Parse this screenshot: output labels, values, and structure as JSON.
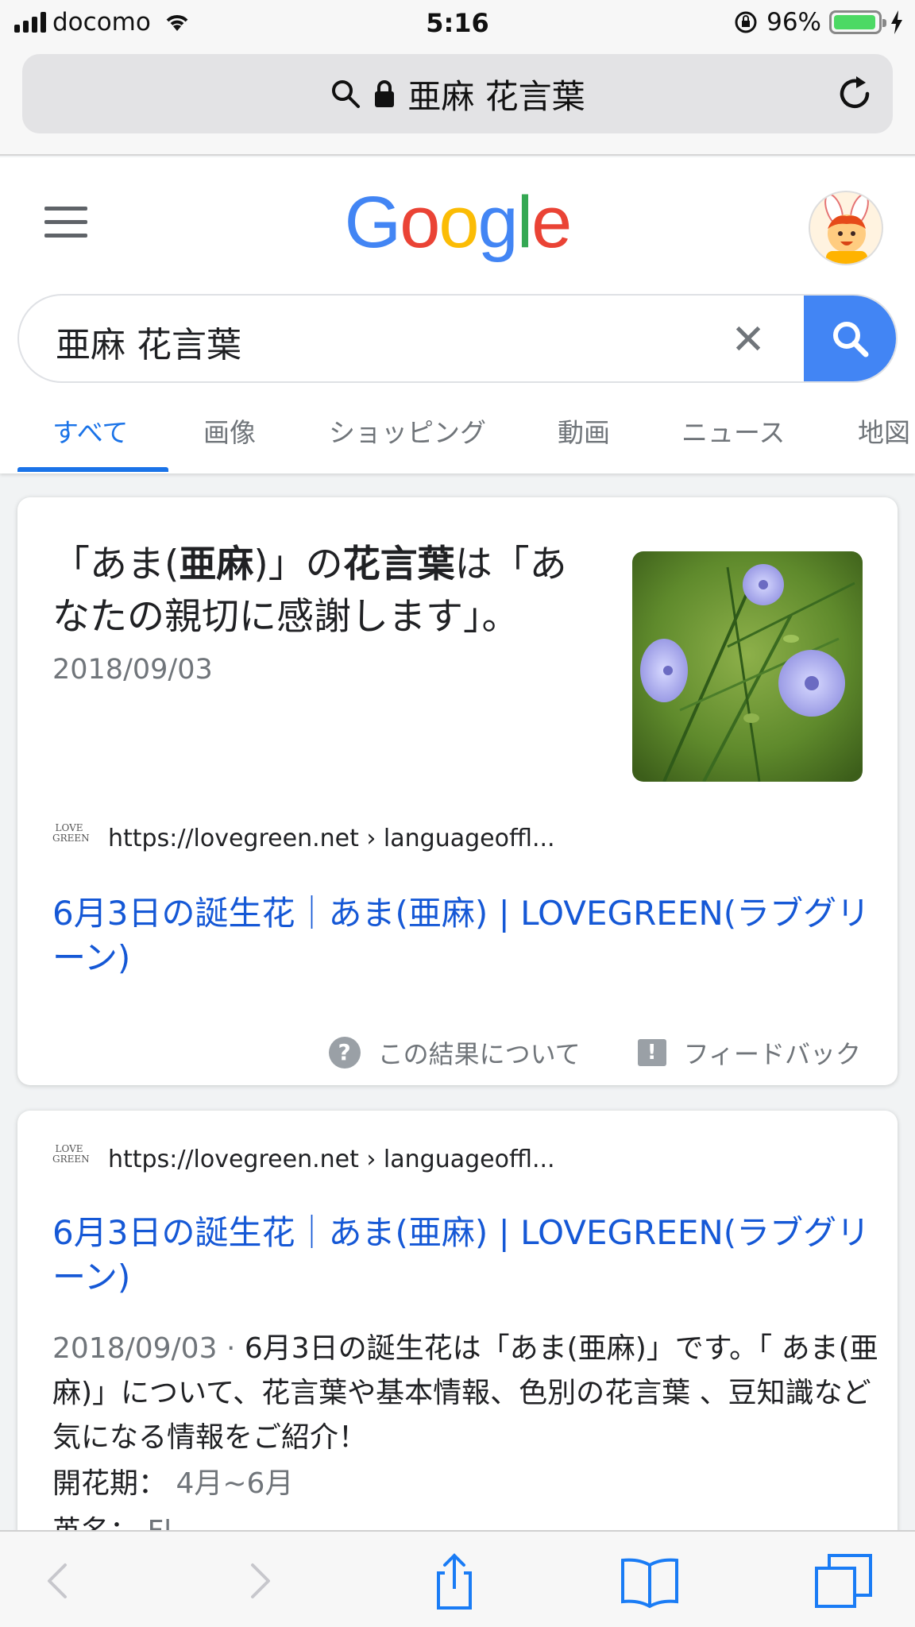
{
  "status_bar": {
    "carrier": "docomo",
    "time": "5:16",
    "battery_percent": "96%",
    "battery_level": 0.96
  },
  "safari": {
    "address_text": "亜麻 花言葉",
    "icons": [
      "search-icon",
      "lock-icon",
      "reload-icon"
    ]
  },
  "google": {
    "logo_letters": [
      {
        "char": "G",
        "color": "#4285F4"
      },
      {
        "char": "o",
        "color": "#EA4335"
      },
      {
        "char": "o",
        "color": "#FBBC05"
      },
      {
        "char": "g",
        "color": "#4285F4"
      },
      {
        "char": "l",
        "color": "#34A853"
      },
      {
        "char": "e",
        "color": "#EA4335"
      }
    ],
    "search_query": "亜麻 花言葉",
    "tabs": [
      "すべて",
      "画像",
      "ショッピング",
      "動画",
      "ニュース",
      "地図"
    ],
    "active_tab": "すべて"
  },
  "featured_snippet": {
    "title_parts": [
      "「あま(",
      "亜麻",
      ")」の",
      "花言葉",
      "は「あなたの親切に感謝します」。"
    ],
    "date": "2018/09/03",
    "favicon_text": [
      "LOVE",
      "GREEN"
    ],
    "site_url": "https://lovegreen.net › languageoffl...",
    "result_title": "6月3日の誕生花｜あま(亜麻) | LOVEGREEN(ラブグリーン)",
    "about_label": "この結果について",
    "feedback_label": "フィードバック"
  },
  "result_1": {
    "favicon_text": [
      "LOVE",
      "GREEN"
    ],
    "site_url": "https://lovegreen.net › languageoffl...",
    "title": "6月3日の誕生花｜あま(亜麻) | LOVEGREEN(ラブグリーン)",
    "date": "2018/09/03",
    "date_separator": " · ",
    "snippet": "6月3日の誕生花は「あま(亜麻)」です。「 あま(亜麻)」について、花言葉や基本情報、色別の花言葉 、豆知識など気になる情報をご紹介！",
    "bloom_label": "開花期：",
    "bloom_value": "4月~6月",
    "cut_label": "英名：",
    "cut_value": "Fl"
  },
  "colors": {
    "google_blue": "#4285F4",
    "link_blue": "#1558D6",
    "tab_active": "#1A73E8",
    "safari_blue": "#1A7CF5",
    "battery_green": "#4CD964"
  }
}
